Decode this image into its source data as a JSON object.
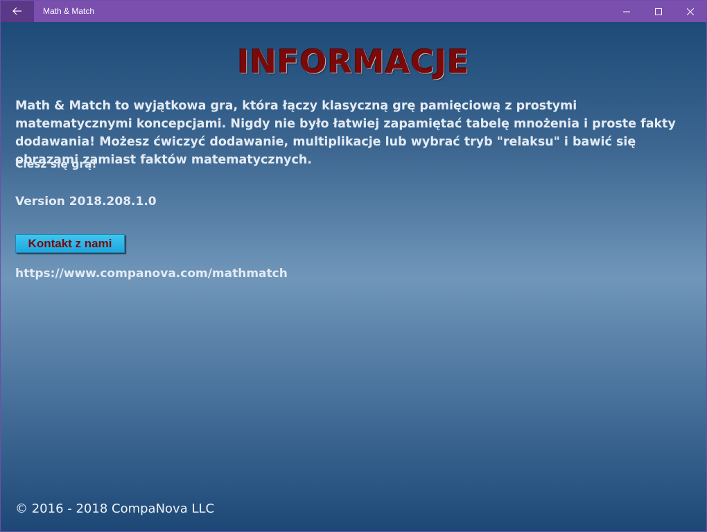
{
  "window": {
    "title": "Math & Match"
  },
  "icons": {
    "back": "back-arrow-icon",
    "minimize": "minimize-icon",
    "maximize": "maximize-icon",
    "close": "close-icon"
  },
  "page": {
    "heading": "INFORMACJE",
    "description": "Math & Match to wyjątkowa gra, która łączy klasyczną grę pamięciową z prostymi matematycznymi koncepcjami. Nigdy nie było łatwiej zapamiętać tabelę mnożenia i proste fakty dodawania! Możesz ćwiczyć dodawanie, multiplikacje lub wybrać tryb \"relaksu\" i bawić się obrazami zamiast faktów matematycznych.",
    "enjoy": "Ciesz się grą!",
    "version": "Version 2018.208.1.0",
    "contact_button": "Kontakt z nami",
    "url": "https://www.companova.com/mathmatch",
    "copyright": "© 2016 - 2018 CompaNova LLC"
  },
  "colors": {
    "titlebar": "#7a4fae",
    "back_button": "#5b3888",
    "heading": "#7a0a0a",
    "button_bg": "#1ea7df",
    "button_text": "#7a0a0a"
  }
}
